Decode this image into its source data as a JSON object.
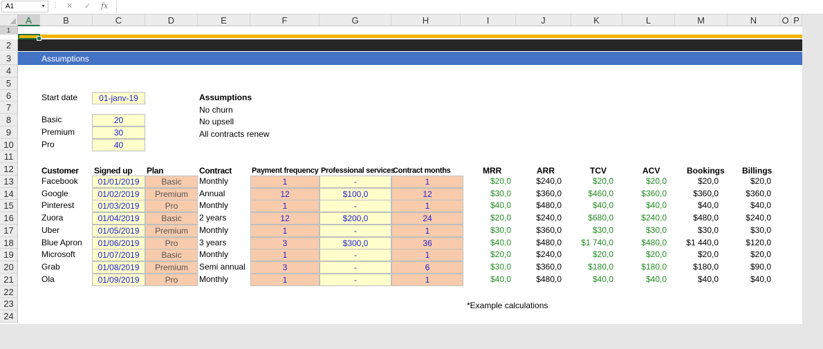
{
  "formula_bar": {
    "cell_ref": "A1",
    "fx": "fx",
    "cancel": "✕",
    "enter": "✓"
  },
  "columns": [
    "A",
    "B",
    "C",
    "D",
    "E",
    "F",
    "G",
    "H",
    "I",
    "J",
    "K",
    "L",
    "M",
    "N",
    "O",
    "P"
  ],
  "rows": [
    "1",
    "2",
    "3",
    "4",
    "5",
    "6",
    "7",
    "8",
    "9",
    "10",
    "11",
    "12",
    "13",
    "14",
    "15",
    "16",
    "17",
    "18",
    "19",
    "20",
    "21",
    "22",
    "23",
    "24"
  ],
  "section_title": "Assumptions",
  "start_date": {
    "label": "Start date",
    "value": "01-janv-19"
  },
  "plans_pricing": [
    {
      "label": "Basic",
      "value": "20"
    },
    {
      "label": "Premium",
      "value": "30"
    },
    {
      "label": "Pro",
      "value": "40"
    }
  ],
  "assumptions_note": {
    "title": "Assumptions",
    "lines": [
      "No churn",
      "No upsell",
      "All contracts renew"
    ]
  },
  "table_headers": {
    "customer": "Customer",
    "signed_up": "Signed up",
    "plan": "Plan",
    "contract": "Contract",
    "payment_frequency": "Payment frequency",
    "professional_services": "Professional services",
    "contract_months": "Contract months",
    "mrr": "MRR",
    "arr": "ARR",
    "tcv": "TCV",
    "acv": "ACV",
    "bookings": "Bookings",
    "billings": "Billings"
  },
  "table_rows": [
    {
      "customer": "Facebook",
      "signed_up": "01/01/2019",
      "plan": "Basic",
      "contract": "Monthly",
      "payment_frequency": "1",
      "professional_services": "-",
      "contract_months": "1",
      "mrr": "$20,0",
      "arr": "$240,0",
      "tcv": "$20,0",
      "acv": "$20,0",
      "bookings": "$20,0",
      "billings": "$20,0"
    },
    {
      "customer": "Google",
      "signed_up": "01/02/2019",
      "plan": "Premium",
      "contract": "Annual",
      "payment_frequency": "12",
      "professional_services": "$100,0",
      "contract_months": "12",
      "mrr": "$30,0",
      "arr": "$360,0",
      "tcv": "$460,0",
      "acv": "$360,0",
      "bookings": "$360,0",
      "billings": "$360,0"
    },
    {
      "customer": "Pinterest",
      "signed_up": "01/03/2019",
      "plan": "Pro",
      "contract": "Monthly",
      "payment_frequency": "1",
      "professional_services": "-",
      "contract_months": "1",
      "mrr": "$40,0",
      "arr": "$480,0",
      "tcv": "$40,0",
      "acv": "$40,0",
      "bookings": "$40,0",
      "billings": "$40,0"
    },
    {
      "customer": "Zuora",
      "signed_up": "01/04/2019",
      "plan": "Basic",
      "contract": "2 years",
      "payment_frequency": "12",
      "professional_services": "$200,0",
      "contract_months": "24",
      "mrr": "$20,0",
      "arr": "$240,0",
      "tcv": "$680,0",
      "acv": "$240,0",
      "bookings": "$480,0",
      "billings": "$240,0"
    },
    {
      "customer": "Uber",
      "signed_up": "01/05/2019",
      "plan": "Premium",
      "contract": "Monthly",
      "payment_frequency": "1",
      "professional_services": "-",
      "contract_months": "1",
      "mrr": "$30,0",
      "arr": "$360,0",
      "tcv": "$30,0",
      "acv": "$30,0",
      "bookings": "$30,0",
      "billings": "$30,0"
    },
    {
      "customer": "Blue Apron",
      "signed_up": "01/06/2019",
      "plan": "Pro",
      "contract": "3 years",
      "payment_frequency": "3",
      "professional_services": "$300,0",
      "contract_months": "36",
      "mrr": "$40,0",
      "arr": "$480,0",
      "tcv": "$1 740,0",
      "acv": "$480,0",
      "bookings": "$1 440,0",
      "billings": "$120,0"
    },
    {
      "customer": "Microsoft",
      "signed_up": "01/07/2019",
      "plan": "Basic",
      "contract": "Monthly",
      "payment_frequency": "1",
      "professional_services": "-",
      "contract_months": "1",
      "mrr": "$20,0",
      "arr": "$240,0",
      "tcv": "$20,0",
      "acv": "$20,0",
      "bookings": "$20,0",
      "billings": "$20,0"
    },
    {
      "customer": "Grab",
      "signed_up": "01/08/2019",
      "plan": "Premium",
      "contract": "Semi annual",
      "payment_frequency": "3",
      "professional_services": "-",
      "contract_months": "6",
      "mrr": "$30,0",
      "arr": "$360,0",
      "tcv": "$180,0",
      "acv": "$180,0",
      "bookings": "$180,0",
      "billings": "$90,0"
    },
    {
      "customer": "Ola",
      "signed_up": "01/09/2019",
      "plan": "Pro",
      "contract": "Monthly",
      "payment_frequency": "1",
      "professional_services": "-",
      "contract_months": "1",
      "mrr": "$40,0",
      "arr": "$480,0",
      "tcv": "$40,0",
      "acv": "$40,0",
      "bookings": "$40,0",
      "billings": "$40,0"
    }
  ],
  "footnote": "*Example calculations",
  "colors": {
    "input_yellow": "#ffffcc",
    "input_orange": "#f8cbad",
    "header_blue": "#4472c4",
    "accent_gold": "#f0b400",
    "formula_green": "#218c21",
    "input_blue": "#1f1fd0"
  }
}
